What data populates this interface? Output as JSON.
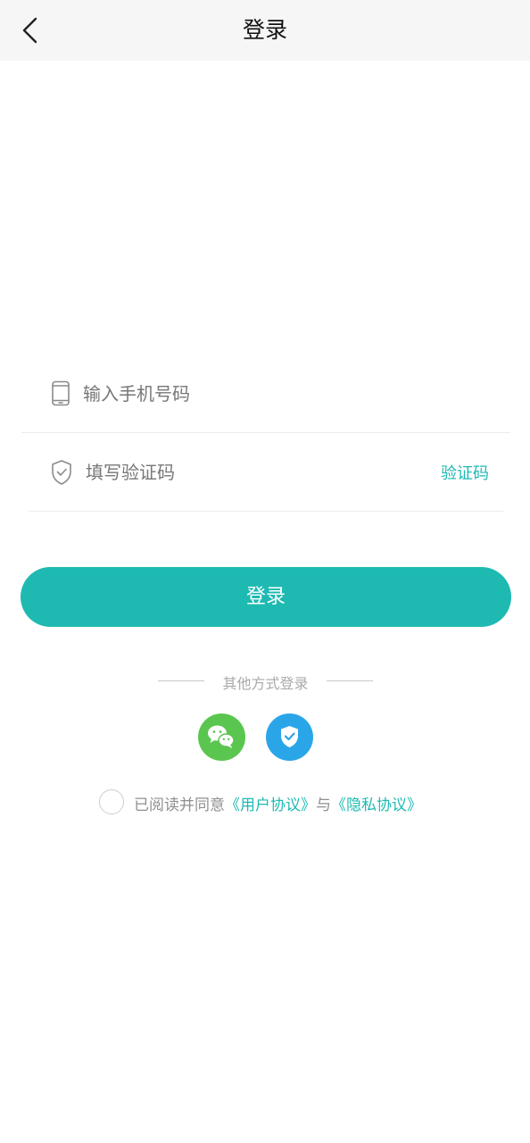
{
  "header": {
    "title": "登录",
    "back_icon": "chevron-left-icon"
  },
  "form": {
    "phone": {
      "placeholder": "输入手机号码",
      "value": "",
      "icon": "phone-icon"
    },
    "code": {
      "placeholder": "填写验证码",
      "value": "",
      "icon": "shield-check-icon",
      "get_code_label": "验证码"
    },
    "login_label": "登录"
  },
  "other_login": {
    "label": "其他方式登录",
    "options": [
      {
        "name": "wechat",
        "icon": "wechat-icon",
        "color": "#5ac64f"
      },
      {
        "name": "secure",
        "icon": "shield-check-icon",
        "color": "#2aa6e8"
      }
    ]
  },
  "agreement": {
    "prefix": "已阅读并同意",
    "user_agreement": "《用户协议》",
    "and": "与",
    "privacy_agreement": "《隐私协议》",
    "checked": false
  },
  "colors": {
    "accent": "#1ebab2",
    "header_bg": "#f6f6f6"
  }
}
